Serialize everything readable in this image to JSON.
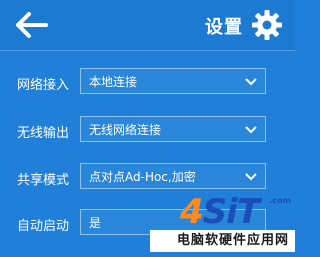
{
  "header": {
    "title": "设置"
  },
  "settings": [
    {
      "label": "网络接入",
      "value": "本地连接"
    },
    {
      "label": "无线输出",
      "value": "无线网络连接"
    },
    {
      "label": "共享模式",
      "value": "点对点Ad-Hoc,加密"
    },
    {
      "label": "自动启动",
      "value": "是"
    }
  ],
  "watermark": {
    "logo_4": "4",
    "logo_s": "S",
    "logo_i": "i",
    "logo_t": "T",
    "logo_com": ".com",
    "subtitle": "电脑软硬件应用网"
  },
  "colors": {
    "background": "#1f7fd9",
    "header": "#1c7ad2",
    "field_border": "#8cc2f2",
    "watermark_orange": "#ff8a1e",
    "watermark_blue": "#1a4fb8"
  }
}
